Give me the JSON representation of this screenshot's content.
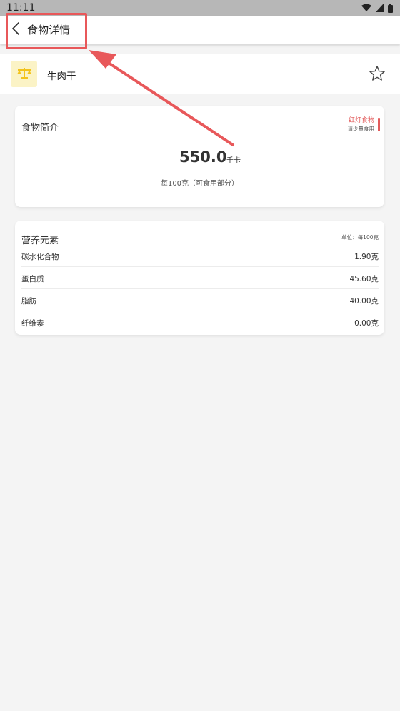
{
  "status_bar": {
    "time": "11:11",
    "icons": [
      "wifi-icon",
      "signal-icon",
      "battery-icon"
    ]
  },
  "top_bar": {
    "title": "食物详情",
    "back_icon": "chevron-left-icon"
  },
  "food": {
    "name": "牛肉干",
    "icon": "scale-icon",
    "icon_bg": "#fbf3c6",
    "favorite_icon": "star-outline-icon"
  },
  "intro": {
    "title": "食物简介",
    "tag_title": "红灯食物",
    "tag_subtitle": "请少量食用",
    "tag_color": "#e25b5b",
    "calories": "550.0",
    "calorie_unit": "千卡",
    "per_unit": "每100克（可食用部分）"
  },
  "nutrients": {
    "title": "营养元素",
    "unit_note": "单位：每100克",
    "items": [
      {
        "label": "碳水化合物",
        "value": "1.90克"
      },
      {
        "label": "蛋白质",
        "value": "45.60克"
      },
      {
        "label": "脂肪",
        "value": "40.00克"
      },
      {
        "label": "纤维素",
        "value": "0.00克"
      }
    ]
  },
  "annotation_color": "#e8585a"
}
